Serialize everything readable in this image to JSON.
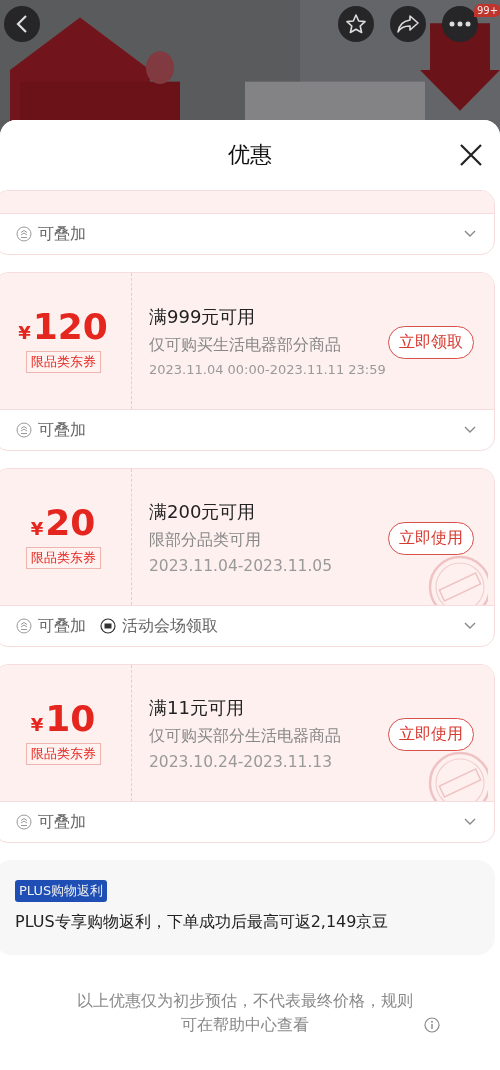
{
  "top_bar": {
    "badge": "99+"
  },
  "sheet": {
    "title": "优惠"
  },
  "coupons": [
    {
      "kind": "cut",
      "tags": [
        {
          "kind": "stack",
          "label": "可叠加"
        }
      ]
    },
    {
      "kind": "full",
      "currency": "¥",
      "amount": "120",
      "type_label": "限品类东券",
      "threshold": "满999元可用",
      "scope": "仅可购买生活电器部分商品",
      "validity": "2023.11.04 00:00-2023.11.11 23:59",
      "button": "立即领取",
      "claimed": false,
      "tags": [
        {
          "kind": "stack",
          "label": "可叠加"
        }
      ]
    },
    {
      "kind": "full",
      "currency": "¥",
      "amount": "20",
      "type_label": "限品类东券",
      "threshold": "满200元可用",
      "scope": "限部分品类可用",
      "validity": "2023.11.04-2023.11.05",
      "button": "立即使用",
      "claimed": true,
      "tags": [
        {
          "kind": "stack",
          "label": "可叠加"
        },
        {
          "kind": "venue",
          "label": "活动会场领取"
        }
      ]
    },
    {
      "kind": "full",
      "currency": "¥",
      "amount": "10",
      "type_label": "限品类东券",
      "threshold": "满11元可用",
      "scope": "仅可购买部分生活电器商品",
      "validity": "2023.10.24-2023.11.13",
      "button": "立即使用",
      "claimed": true,
      "tags": [
        {
          "kind": "stack",
          "label": "可叠加"
        }
      ]
    }
  ],
  "plus": {
    "badge": "PLUS购物返利",
    "text": "PLUS专享购物返利，下单成功后最高可返2,149京豆"
  },
  "note": "以上优惠仅为初步预估，不代表最终价格，规则可在帮助中心查看"
}
